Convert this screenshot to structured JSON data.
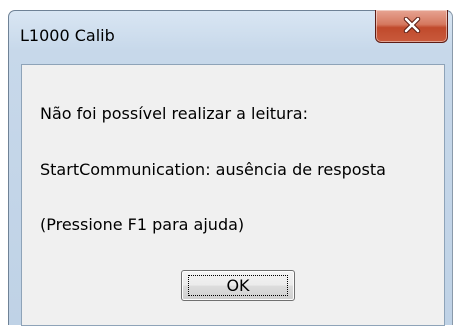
{
  "window": {
    "title": "L1000 Calib",
    "close_icon": "close-x-icon"
  },
  "message": {
    "line1": "Não foi possível realizar a leitura:",
    "line2": "StartCommunication: ausência de resposta",
    "line3": "(Pressione F1 para ajuda)"
  },
  "buttons": {
    "ok_label": "OK"
  },
  "colors": {
    "close_button": "#c95a3c",
    "title_bar": "#c7d8ea",
    "client_area": "#f0f0f0"
  }
}
